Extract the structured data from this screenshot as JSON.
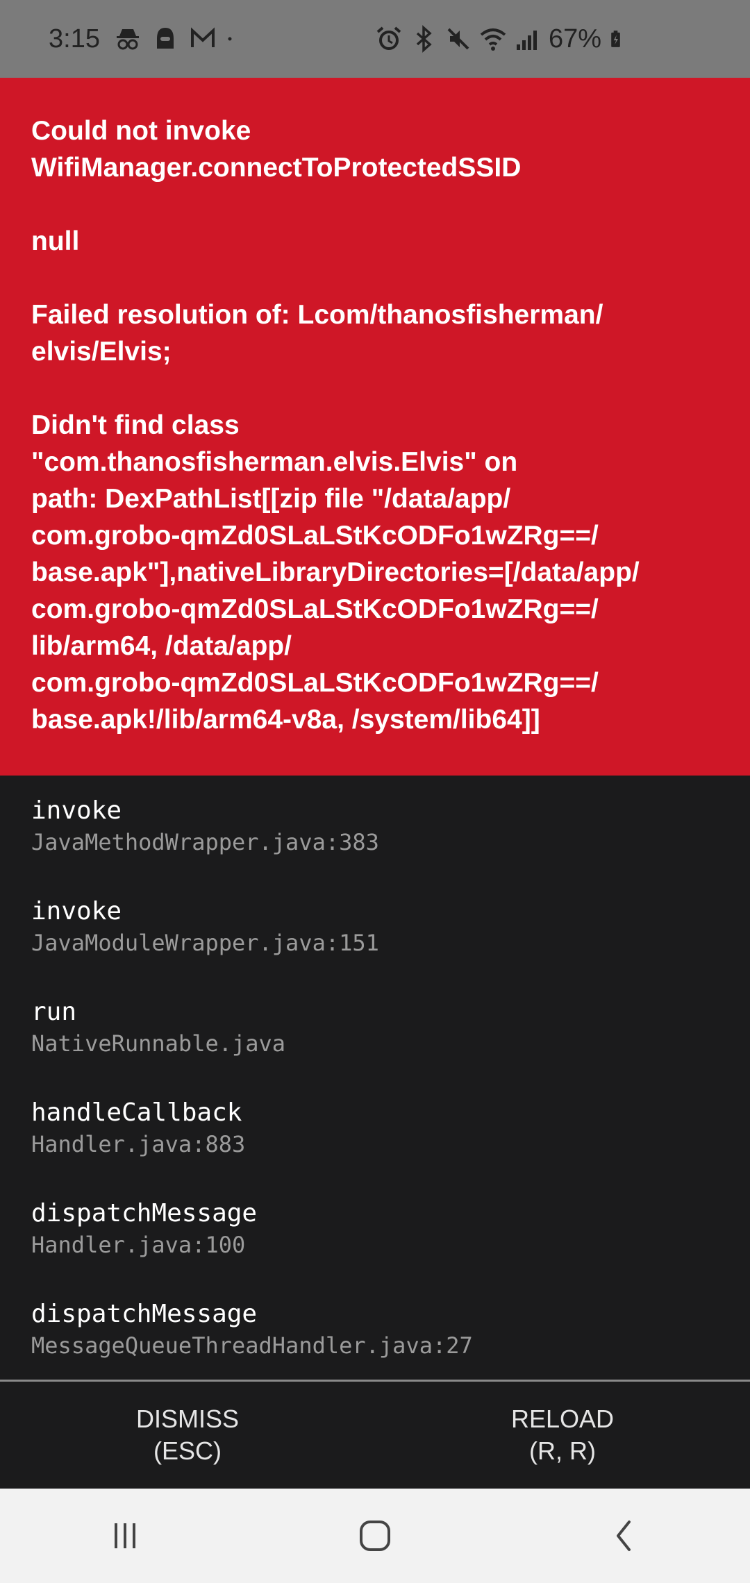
{
  "status_bar": {
    "time": "3:15",
    "battery_percent": "67%",
    "left_icons": [
      "incognito-icon",
      "vpn-icon",
      "gmail-icon",
      "dot-icon"
    ],
    "right_icons": [
      "alarm-icon",
      "bluetooth-icon",
      "mute-icon",
      "wifi-icon",
      "signal-icon",
      "battery-charging-icon"
    ]
  },
  "error": {
    "message": "Could not invoke\nWifiManager.connectToProtectedSSID\n\nnull\n\nFailed resolution of: Lcom/thanosfisherman/\nelvis/Elvis;\n\nDidn't find class\n\"com.thanosfisherman.elvis.Elvis\" on\npath: DexPathList[[zip file \"/data/app/\ncom.grobo-qmZd0SLaLStKcODFo1wZRg==/\nbase.apk\"],nativeLibraryDirectories=[/data/app/\ncom.grobo-qmZd0SLaLStKcODFo1wZRg==/\nlib/arm64, /data/app/\ncom.grobo-qmZd0SLaLStKcODFo1wZRg==/\nbase.apk!/lib/arm64-v8a, /system/lib64]]",
    "background_color": "#cf1727"
  },
  "stack_trace": [
    {
      "method": "invoke",
      "file": "JavaMethodWrapper.java:383"
    },
    {
      "method": "invoke",
      "file": "JavaModuleWrapper.java:151"
    },
    {
      "method": "run",
      "file": "NativeRunnable.java"
    },
    {
      "method": "handleCallback",
      "file": "Handler.java:883"
    },
    {
      "method": "dispatchMessage",
      "file": "Handler.java:100"
    },
    {
      "method": "dispatchMessage",
      "file": "MessageQueueThreadHandler.java:27"
    }
  ],
  "buttons": {
    "dismiss_line1": "DISMISS",
    "dismiss_line2": "(ESC)",
    "reload_line1": "RELOAD",
    "reload_line2": "(R, R)"
  },
  "nav_bar": {
    "icons": [
      "recents-icon",
      "home-icon",
      "back-icon"
    ]
  }
}
